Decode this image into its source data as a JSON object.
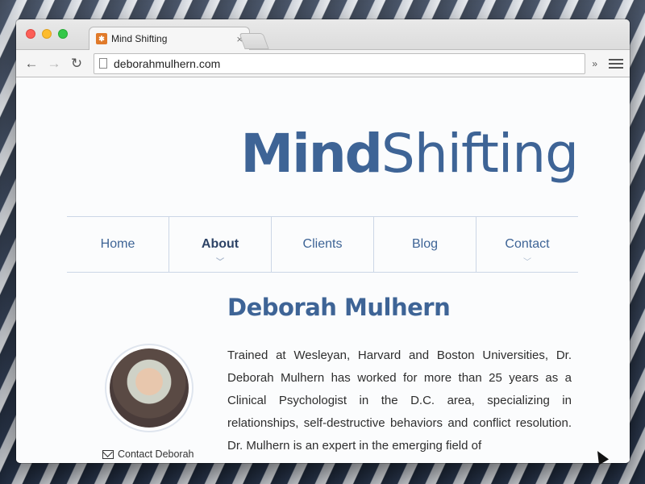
{
  "browser": {
    "tab_title": "Mind Shifting",
    "tab_close": "×",
    "url": "deborahmulhern.com",
    "overflow_chevron": "»"
  },
  "site": {
    "logo_bold": "Mind",
    "logo_light": "Shifting",
    "nav": [
      {
        "label": "Home",
        "active": false
      },
      {
        "label": "About",
        "active": true
      },
      {
        "label": "Clients",
        "active": false
      },
      {
        "label": "Blog",
        "active": false
      },
      {
        "label": "Contact",
        "active": false
      }
    ],
    "heading": "Deborah Mulhern",
    "contact_label": "Contact Deborah",
    "bio": "Trained at Wesleyan, Harvard and Boston Universities, Dr. Deborah Mulhern has worked for more than 25 years as a Clinical Psychologist in the D.C. area, specializing in relationships, self-destructive behaviors and conflict resolution. Dr. Mulhern is an expert in the emerging field of"
  },
  "colors": {
    "brand_blue": "#3e6496",
    "nav_active": "#2d4366"
  }
}
